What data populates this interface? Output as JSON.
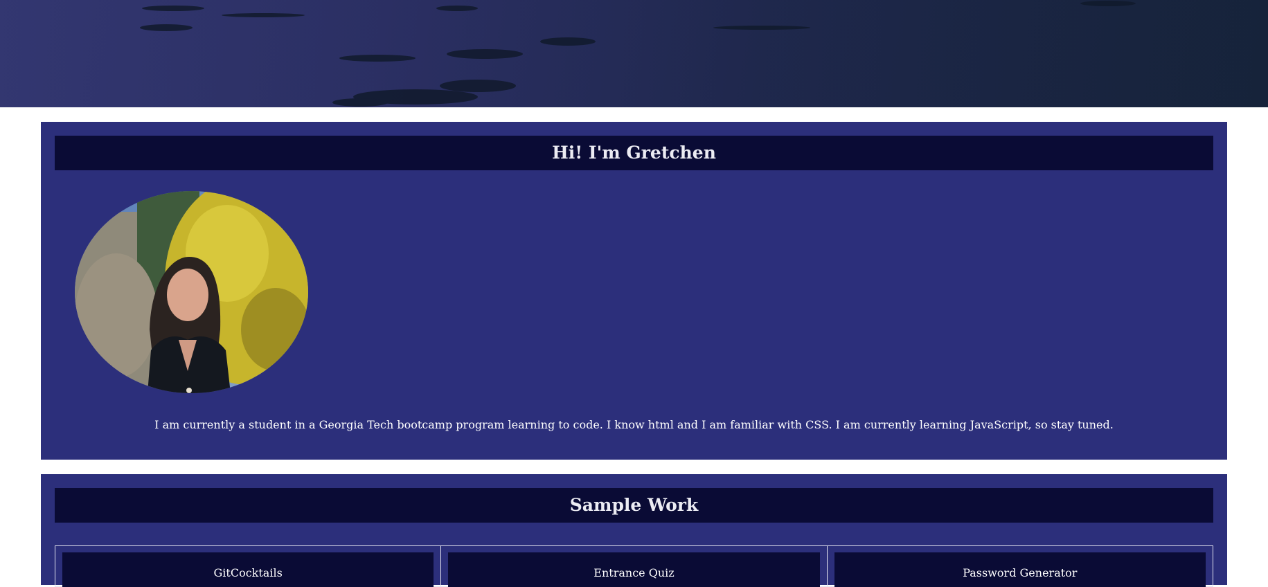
{
  "about": {
    "heading": "Hi! I'm Gretchen",
    "bio": "I am currently a student in a Georgia Tech bootcamp program learning to code. I know html and I am familiar with CSS. I am currently learning JavaScript, so stay tuned."
  },
  "work": {
    "heading": "Sample Work",
    "projects": [
      {
        "title": "GitCocktails"
      },
      {
        "title": "Entrance Quiz"
      },
      {
        "title": "Password Generator"
      }
    ]
  },
  "colors": {
    "section_bg": "#2c2f7b",
    "header_bg": "#0a0b35",
    "page_bg": "#ffffff"
  }
}
